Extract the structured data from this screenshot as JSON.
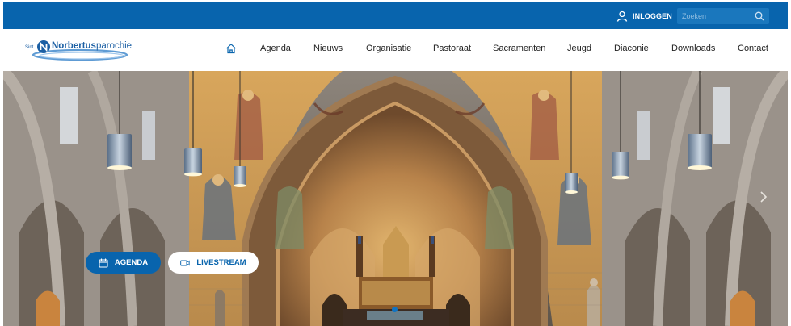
{
  "topbar": {
    "login_label": "INLOGGEN",
    "search_placeholder": "Zoeken",
    "color": "#0864ad"
  },
  "logo": {
    "prefix": "Sint",
    "name_bold": "Norbertus",
    "name_rest": "parochie"
  },
  "nav": {
    "home_icon": "home-icon",
    "items": [
      {
        "label": "Agenda"
      },
      {
        "label": "Nieuws"
      },
      {
        "label": "Organisatie"
      },
      {
        "label": "Pastoraat"
      },
      {
        "label": "Sacramenten"
      },
      {
        "label": "Jeugd"
      },
      {
        "label": "Diaconie"
      },
      {
        "label": "Downloads"
      },
      {
        "label": "Contact"
      }
    ]
  },
  "hero": {
    "buttons": {
      "agenda": {
        "label": "AGENDA",
        "icon": "calendar-icon"
      },
      "livestream": {
        "label": "LIVESTREAM",
        "icon": "video-camera-icon"
      }
    },
    "carousel": {
      "next_icon": "chevron-right-icon",
      "slide_count_shown": 1
    }
  },
  "colors": {
    "brand_blue": "#0864ad",
    "white": "#ffffff"
  }
}
